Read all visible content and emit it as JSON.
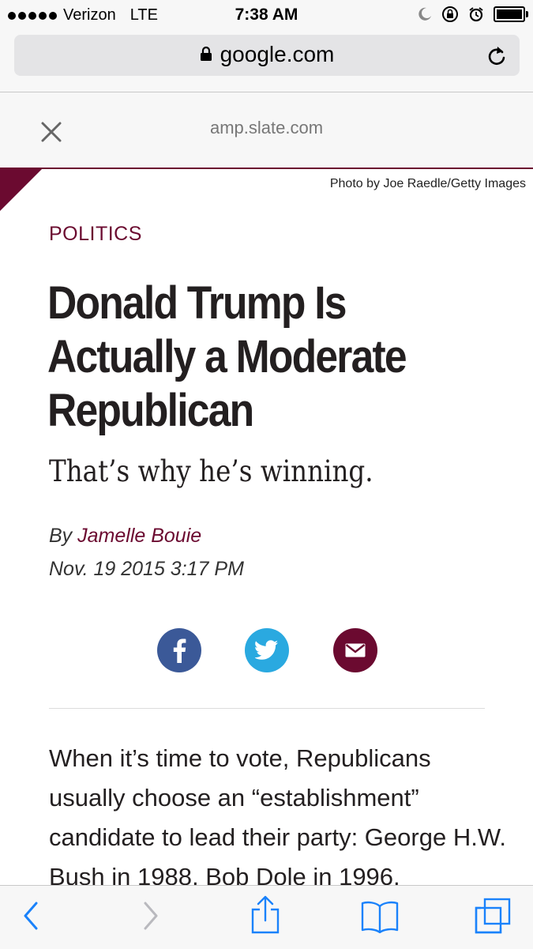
{
  "status_bar": {
    "carrier": "Verizon",
    "network": "LTE",
    "time": "7:38 AM"
  },
  "browser": {
    "url": "google.com"
  },
  "amp_header": {
    "host": "amp.slate.com"
  },
  "article": {
    "photo_credit": "Photo by Joe Raedle/Getty Images",
    "section": "POLITICS",
    "headline_line1": "Donald Trump Is",
    "headline_line2": "Actually a Moderate",
    "headline_line3": "Republican",
    "subheadline": "That’s why he’s winning.",
    "byline_prefix": "By",
    "author": "Jamelle Bouie",
    "date": "Nov. 19 2015 3:17 PM",
    "body": "When it’s time to vote, Republicans usually choose an “establishment” candidate to lead their party: George H.W. Bush in 1988, Bob Dole in 1996,"
  },
  "share": {
    "icons": [
      "facebook-icon",
      "twitter-icon",
      "email-icon"
    ]
  },
  "toolbar": {
    "icons": [
      "back-icon",
      "forward-icon",
      "share-icon",
      "bookmarks-icon",
      "tabs-icon"
    ]
  },
  "colors": {
    "accent": "#6b0a30",
    "facebook": "#3b5998",
    "twitter": "#2aa9e0",
    "ios_blue": "#1a82fb"
  }
}
